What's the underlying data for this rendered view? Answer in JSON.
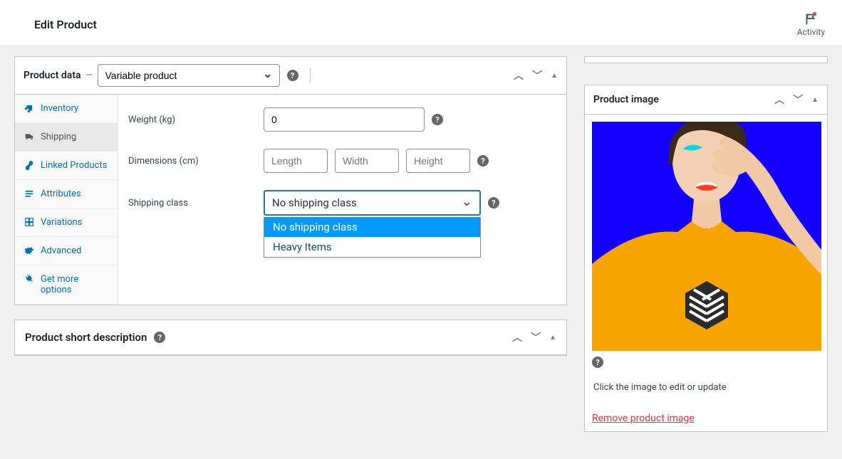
{
  "header": {
    "title": "Edit Product",
    "activity_label": "Activity"
  },
  "product_data": {
    "panel_title": "Product data",
    "type_options": [
      "Variable product"
    ],
    "type_selected": "Variable product",
    "tabs": {
      "inventory": "Inventory",
      "shipping": "Shipping",
      "linked": "Linked Products",
      "attributes": "Attributes",
      "variations": "Variations",
      "advanced": "Advanced",
      "get_more": "Get more options"
    },
    "shipping": {
      "weight_label": "Weight (kg)",
      "weight_value": "0",
      "dimensions_label": "Dimensions (cm)",
      "length_ph": "Length",
      "width_ph": "Width",
      "height_ph": "Height",
      "class_label": "Shipping class",
      "class_selected": "No shipping class",
      "class_options": [
        "No shipping class",
        "Heavy Items"
      ]
    }
  },
  "short_desc": {
    "title": "Product short description"
  },
  "product_image": {
    "panel_title": "Product image",
    "hint": "Click the image to edit or update",
    "remove_label": "Remove product image"
  }
}
